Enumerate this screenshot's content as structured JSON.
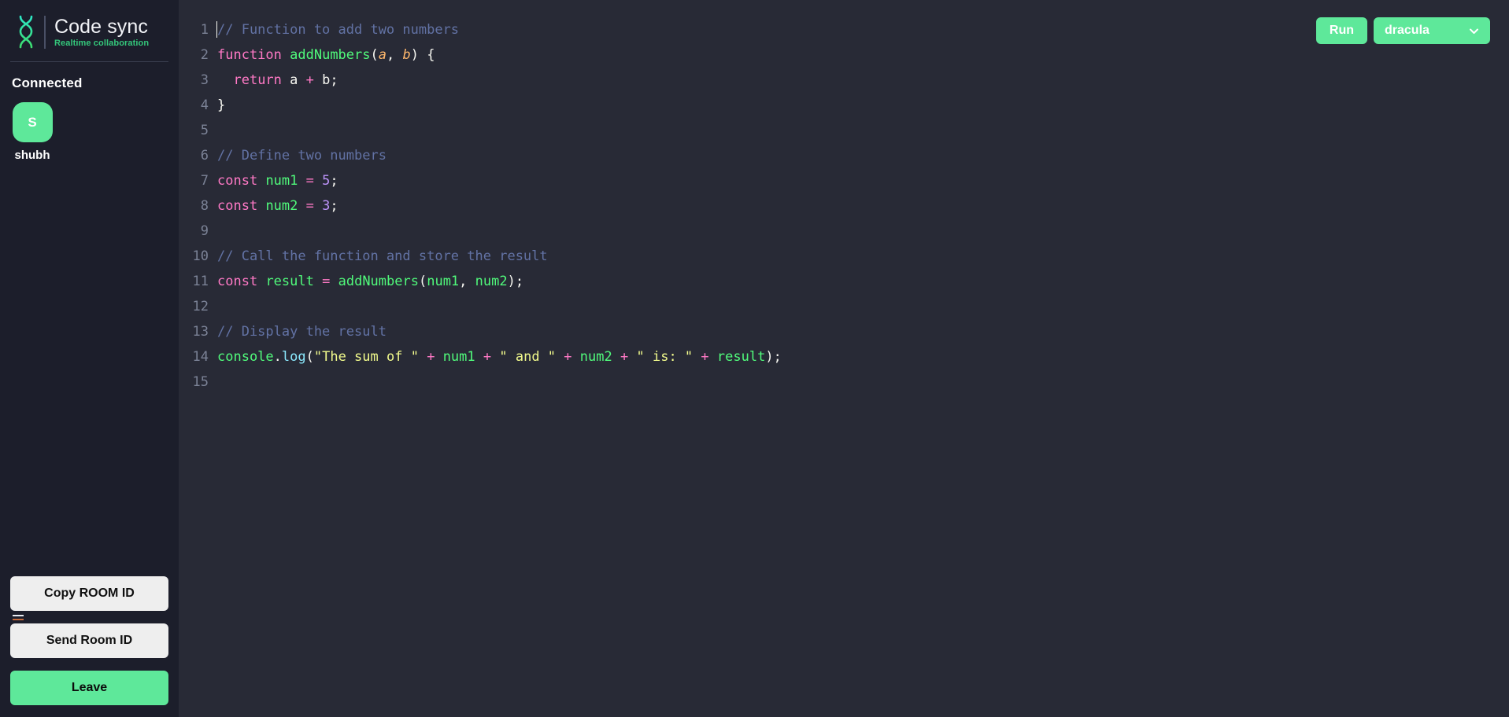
{
  "brand": {
    "title": "Code sync",
    "subtitle": "Realtime collaboration",
    "logo_icon": "dna-helix-icon",
    "accent_green": "#5ee89a",
    "accent_teal": "#2ee6c5"
  },
  "sidebar": {
    "connected_heading": "Connected",
    "clients": [
      {
        "initial": "S",
        "name": "shubh"
      }
    ],
    "buttons": {
      "copy_room_id": "Copy ROOM ID",
      "send_room_id": "Send Room ID",
      "leave": "Leave"
    }
  },
  "toolbar": {
    "run_label": "Run",
    "theme_value": "dracula",
    "theme_options": [
      "dracula"
    ],
    "chevron_icon": "chevron-down-icon"
  },
  "editor": {
    "language": "javascript",
    "theme": "dracula",
    "cursor_line": 1,
    "cursor_column": 1,
    "total_lines": 15,
    "line_numbers": [
      "1",
      "2",
      "3",
      "4",
      "5",
      "6",
      "7",
      "8",
      "9",
      "10",
      "11",
      "12",
      "13",
      "14",
      "15"
    ],
    "lines": [
      {
        "n": "1",
        "tokens": [
          {
            "t": "com",
            "v": "// Function to add two numbers"
          }
        ]
      },
      {
        "n": "2",
        "tokens": [
          {
            "t": "key",
            "v": "function"
          },
          {
            "t": "pun",
            "v": " "
          },
          {
            "t": "fn",
            "v": "addNumbers"
          },
          {
            "t": "pun",
            "v": "("
          },
          {
            "t": "par",
            "v": "a"
          },
          {
            "t": "pun",
            "v": ", "
          },
          {
            "t": "par",
            "v": "b"
          },
          {
            "t": "pun",
            "v": ") {"
          }
        ]
      },
      {
        "n": "3",
        "tokens": [
          {
            "t": "pun",
            "v": "  "
          },
          {
            "t": "key",
            "v": "return"
          },
          {
            "t": "pun",
            "v": " a "
          },
          {
            "t": "op",
            "v": "+"
          },
          {
            "t": "pun",
            "v": " b;"
          }
        ]
      },
      {
        "n": "4",
        "tokens": [
          {
            "t": "pun",
            "v": "}"
          }
        ]
      },
      {
        "n": "5",
        "tokens": []
      },
      {
        "n": "6",
        "tokens": [
          {
            "t": "com",
            "v": "// Define two numbers"
          }
        ]
      },
      {
        "n": "7",
        "tokens": [
          {
            "t": "key",
            "v": "const"
          },
          {
            "t": "pun",
            "v": " "
          },
          {
            "t": "var",
            "v": "num1"
          },
          {
            "t": "pun",
            "v": " "
          },
          {
            "t": "op",
            "v": "="
          },
          {
            "t": "pun",
            "v": " "
          },
          {
            "t": "num",
            "v": "5"
          },
          {
            "t": "pun",
            "v": ";"
          }
        ]
      },
      {
        "n": "8",
        "tokens": [
          {
            "t": "key",
            "v": "const"
          },
          {
            "t": "pun",
            "v": " "
          },
          {
            "t": "var",
            "v": "num2"
          },
          {
            "t": "pun",
            "v": " "
          },
          {
            "t": "op",
            "v": "="
          },
          {
            "t": "pun",
            "v": " "
          },
          {
            "t": "num",
            "v": "3"
          },
          {
            "t": "pun",
            "v": ";"
          }
        ]
      },
      {
        "n": "9",
        "tokens": []
      },
      {
        "n": "10",
        "tokens": [
          {
            "t": "com",
            "v": "// Call the function and store the result"
          }
        ]
      },
      {
        "n": "11",
        "tokens": [
          {
            "t": "key",
            "v": "const"
          },
          {
            "t": "pun",
            "v": " "
          },
          {
            "t": "var",
            "v": "result"
          },
          {
            "t": "pun",
            "v": " "
          },
          {
            "t": "op",
            "v": "="
          },
          {
            "t": "pun",
            "v": " "
          },
          {
            "t": "fn",
            "v": "addNumbers"
          },
          {
            "t": "pun",
            "v": "("
          },
          {
            "t": "var",
            "v": "num1"
          },
          {
            "t": "pun",
            "v": ", "
          },
          {
            "t": "var",
            "v": "num2"
          },
          {
            "t": "pun",
            "v": ");"
          }
        ]
      },
      {
        "n": "12",
        "tokens": []
      },
      {
        "n": "13",
        "tokens": [
          {
            "t": "com",
            "v": "// Display the result"
          }
        ]
      },
      {
        "n": "14",
        "tokens": [
          {
            "t": "var",
            "v": "console"
          },
          {
            "t": "pun",
            "v": "."
          },
          {
            "t": "prop",
            "v": "log"
          },
          {
            "t": "pun",
            "v": "("
          },
          {
            "t": "str",
            "v": "\"The sum of \""
          },
          {
            "t": "pun",
            "v": " "
          },
          {
            "t": "op",
            "v": "+"
          },
          {
            "t": "pun",
            "v": " "
          },
          {
            "t": "var",
            "v": "num1"
          },
          {
            "t": "pun",
            "v": " "
          },
          {
            "t": "op",
            "v": "+"
          },
          {
            "t": "pun",
            "v": " "
          },
          {
            "t": "str",
            "v": "\" and \""
          },
          {
            "t": "pun",
            "v": " "
          },
          {
            "t": "op",
            "v": "+"
          },
          {
            "t": "pun",
            "v": " "
          },
          {
            "t": "var",
            "v": "num2"
          },
          {
            "t": "pun",
            "v": " "
          },
          {
            "t": "op",
            "v": "+"
          },
          {
            "t": "pun",
            "v": " "
          },
          {
            "t": "str",
            "v": "\" is: \""
          },
          {
            "t": "pun",
            "v": " "
          },
          {
            "t": "op",
            "v": "+"
          },
          {
            "t": "pun",
            "v": " "
          },
          {
            "t": "var",
            "v": "result"
          },
          {
            "t": "pun",
            "v": ");"
          }
        ]
      },
      {
        "n": "15",
        "tokens": []
      }
    ]
  }
}
